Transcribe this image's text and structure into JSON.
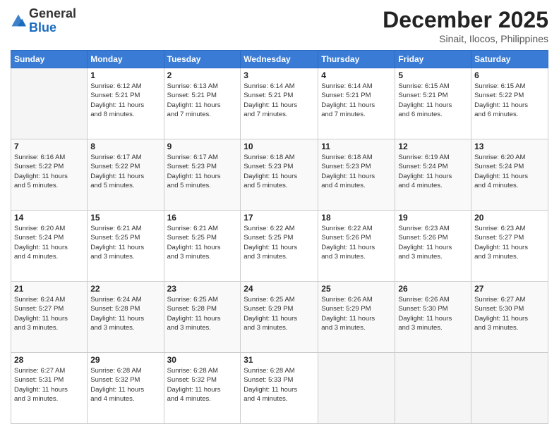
{
  "logo": {
    "general": "General",
    "blue": "Blue"
  },
  "title": "December 2025",
  "location": "Sinait, Ilocos, Philippines",
  "days_header": [
    "Sunday",
    "Monday",
    "Tuesday",
    "Wednesday",
    "Thursday",
    "Friday",
    "Saturday"
  ],
  "weeks": [
    [
      {
        "day": "",
        "info": ""
      },
      {
        "day": "1",
        "info": "Sunrise: 6:12 AM\nSunset: 5:21 PM\nDaylight: 11 hours\nand 8 minutes."
      },
      {
        "day": "2",
        "info": "Sunrise: 6:13 AM\nSunset: 5:21 PM\nDaylight: 11 hours\nand 7 minutes."
      },
      {
        "day": "3",
        "info": "Sunrise: 6:14 AM\nSunset: 5:21 PM\nDaylight: 11 hours\nand 7 minutes."
      },
      {
        "day": "4",
        "info": "Sunrise: 6:14 AM\nSunset: 5:21 PM\nDaylight: 11 hours\nand 7 minutes."
      },
      {
        "day": "5",
        "info": "Sunrise: 6:15 AM\nSunset: 5:21 PM\nDaylight: 11 hours\nand 6 minutes."
      },
      {
        "day": "6",
        "info": "Sunrise: 6:15 AM\nSunset: 5:22 PM\nDaylight: 11 hours\nand 6 minutes."
      }
    ],
    [
      {
        "day": "7",
        "info": "Sunrise: 6:16 AM\nSunset: 5:22 PM\nDaylight: 11 hours\nand 5 minutes."
      },
      {
        "day": "8",
        "info": "Sunrise: 6:17 AM\nSunset: 5:22 PM\nDaylight: 11 hours\nand 5 minutes."
      },
      {
        "day": "9",
        "info": "Sunrise: 6:17 AM\nSunset: 5:23 PM\nDaylight: 11 hours\nand 5 minutes."
      },
      {
        "day": "10",
        "info": "Sunrise: 6:18 AM\nSunset: 5:23 PM\nDaylight: 11 hours\nand 5 minutes."
      },
      {
        "day": "11",
        "info": "Sunrise: 6:18 AM\nSunset: 5:23 PM\nDaylight: 11 hours\nand 4 minutes."
      },
      {
        "day": "12",
        "info": "Sunrise: 6:19 AM\nSunset: 5:24 PM\nDaylight: 11 hours\nand 4 minutes."
      },
      {
        "day": "13",
        "info": "Sunrise: 6:20 AM\nSunset: 5:24 PM\nDaylight: 11 hours\nand 4 minutes."
      }
    ],
    [
      {
        "day": "14",
        "info": "Sunrise: 6:20 AM\nSunset: 5:24 PM\nDaylight: 11 hours\nand 4 minutes."
      },
      {
        "day": "15",
        "info": "Sunrise: 6:21 AM\nSunset: 5:25 PM\nDaylight: 11 hours\nand 3 minutes."
      },
      {
        "day": "16",
        "info": "Sunrise: 6:21 AM\nSunset: 5:25 PM\nDaylight: 11 hours\nand 3 minutes."
      },
      {
        "day": "17",
        "info": "Sunrise: 6:22 AM\nSunset: 5:25 PM\nDaylight: 11 hours\nand 3 minutes."
      },
      {
        "day": "18",
        "info": "Sunrise: 6:22 AM\nSunset: 5:26 PM\nDaylight: 11 hours\nand 3 minutes."
      },
      {
        "day": "19",
        "info": "Sunrise: 6:23 AM\nSunset: 5:26 PM\nDaylight: 11 hours\nand 3 minutes."
      },
      {
        "day": "20",
        "info": "Sunrise: 6:23 AM\nSunset: 5:27 PM\nDaylight: 11 hours\nand 3 minutes."
      }
    ],
    [
      {
        "day": "21",
        "info": "Sunrise: 6:24 AM\nSunset: 5:27 PM\nDaylight: 11 hours\nand 3 minutes."
      },
      {
        "day": "22",
        "info": "Sunrise: 6:24 AM\nSunset: 5:28 PM\nDaylight: 11 hours\nand 3 minutes."
      },
      {
        "day": "23",
        "info": "Sunrise: 6:25 AM\nSunset: 5:28 PM\nDaylight: 11 hours\nand 3 minutes."
      },
      {
        "day": "24",
        "info": "Sunrise: 6:25 AM\nSunset: 5:29 PM\nDaylight: 11 hours\nand 3 minutes."
      },
      {
        "day": "25",
        "info": "Sunrise: 6:26 AM\nSunset: 5:29 PM\nDaylight: 11 hours\nand 3 minutes."
      },
      {
        "day": "26",
        "info": "Sunrise: 6:26 AM\nSunset: 5:30 PM\nDaylight: 11 hours\nand 3 minutes."
      },
      {
        "day": "27",
        "info": "Sunrise: 6:27 AM\nSunset: 5:30 PM\nDaylight: 11 hours\nand 3 minutes."
      }
    ],
    [
      {
        "day": "28",
        "info": "Sunrise: 6:27 AM\nSunset: 5:31 PM\nDaylight: 11 hours\nand 3 minutes."
      },
      {
        "day": "29",
        "info": "Sunrise: 6:28 AM\nSunset: 5:32 PM\nDaylight: 11 hours\nand 4 minutes."
      },
      {
        "day": "30",
        "info": "Sunrise: 6:28 AM\nSunset: 5:32 PM\nDaylight: 11 hours\nand 4 minutes."
      },
      {
        "day": "31",
        "info": "Sunrise: 6:28 AM\nSunset: 5:33 PM\nDaylight: 11 hours\nand 4 minutes."
      },
      {
        "day": "",
        "info": ""
      },
      {
        "day": "",
        "info": ""
      },
      {
        "day": "",
        "info": ""
      }
    ]
  ]
}
